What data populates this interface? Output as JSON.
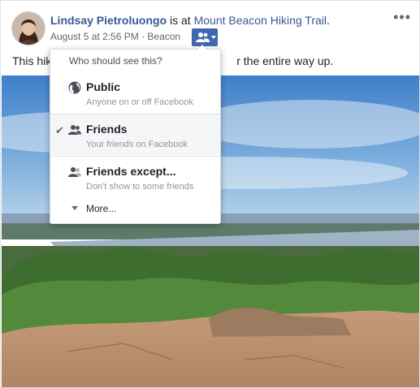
{
  "post": {
    "author": "Lindsay Pietroluongo",
    "is_at": " is at ",
    "location": "Mount Beacon Hiking Trail",
    "period": ".",
    "timestamp": "August 5 at 2:56 PM",
    "separator": " · ",
    "place": "Beacon",
    "text_before": "This hik",
    "text_after": "r the entire way up.",
    "audience_icon": "friends-icon",
    "more_icon": "more-options-icon"
  },
  "audience_menu": {
    "title": "Who should see this?",
    "items": [
      {
        "label": "Public",
        "sub": "Anyone on or off Facebook",
        "icon": "globe-icon",
        "selected": false
      },
      {
        "label": "Friends",
        "sub": "Your friends on Facebook",
        "icon": "friends-icon",
        "selected": true
      },
      {
        "label": "Friends except...",
        "sub": "Don't show to some friends",
        "icon": "friends-except-icon",
        "selected": false
      }
    ],
    "more_label": "More..."
  },
  "colors": {
    "link": "#385898",
    "accent": "#4267b2",
    "meta_text": "#606770",
    "border": "#dddfe2"
  }
}
